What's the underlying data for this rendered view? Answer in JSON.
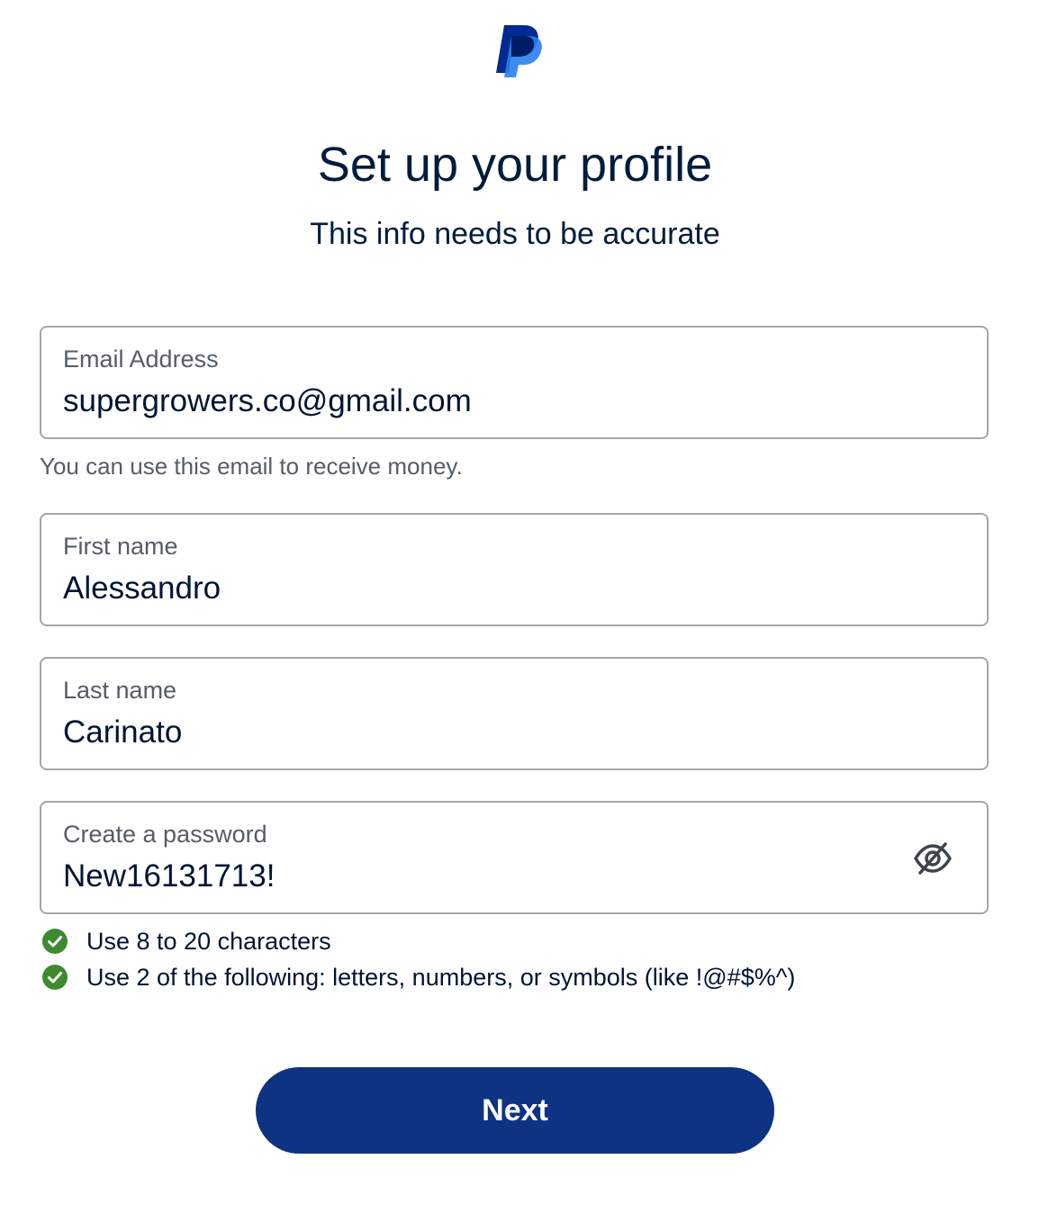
{
  "brand": {
    "logo_icon": "paypal-logo-icon",
    "dark_blue": "#002991",
    "light_blue": "#60cdff"
  },
  "header": {
    "title": "Set up your profile",
    "subtitle": "This info needs to be accurate"
  },
  "form": {
    "email": {
      "label": "Email Address",
      "value": "supergrowers.co@gmail.com",
      "helper": "You can use this email to receive money."
    },
    "first_name": {
      "label": "First name",
      "value": "Alessandro"
    },
    "last_name": {
      "label": "Last name",
      "value": "Carinato"
    },
    "password": {
      "label": "Create a password",
      "value": "New16131713!",
      "toggle_icon": "eye-slash-icon"
    }
  },
  "password_rules": [
    {
      "text": "Use 8 to 20 characters",
      "status": "passed",
      "icon": "check-circle-icon"
    },
    {
      "text": "Use 2 of the following: letters, numbers, or symbols (like !@#$%^)",
      "status": "passed",
      "icon": "check-circle-icon"
    }
  ],
  "actions": {
    "next_label": "Next",
    "button_color": "#0e3383"
  },
  "colors": {
    "success": "#3d8a2f",
    "field_border": "#a3a6ad",
    "text_primary": "#001435",
    "text_secondary": "#545d68"
  }
}
